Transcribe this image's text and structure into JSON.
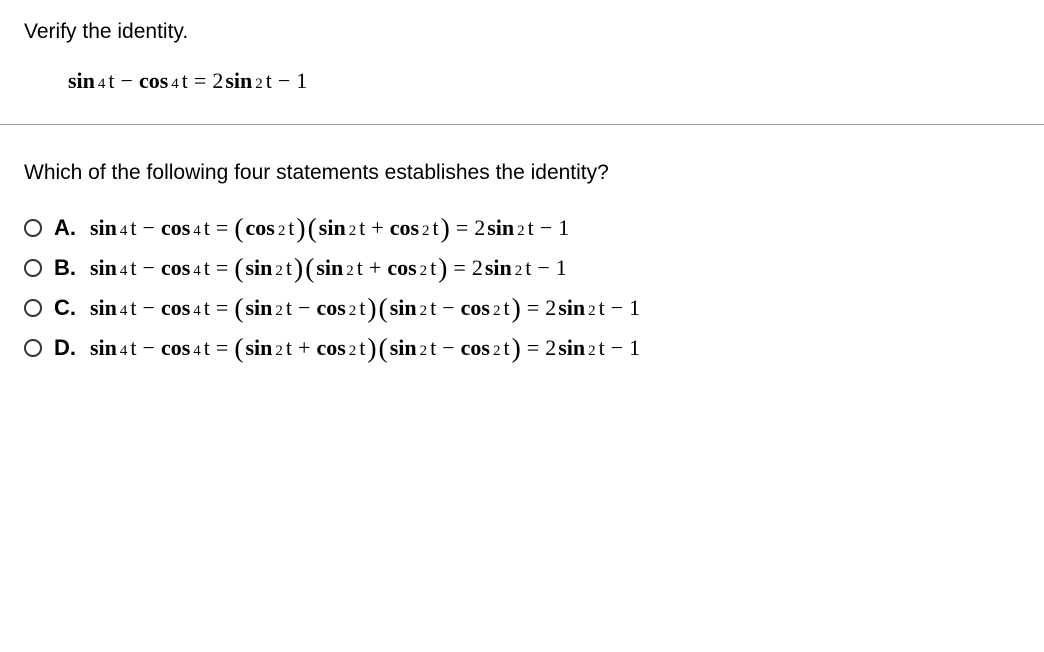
{
  "instruction": "Verify the identity.",
  "main_equation": {
    "lhs_terms": [
      "sin",
      "4",
      "t",
      "−",
      "cos",
      "4",
      "t"
    ],
    "rhs_terms": [
      "2 sin",
      "2",
      "t",
      "−",
      "1"
    ]
  },
  "question": "Which of the following four statements establishes the identity?",
  "choices": [
    {
      "label": "A.",
      "text": "sin⁴ t − cos⁴ t = (cos² t)(sin² t + cos² t) = 2 sin² t − 1"
    },
    {
      "label": "B.",
      "text": "sin⁴ t − cos⁴ t = (sin² t)(sin² t + cos² t) = 2 sin² t − 1"
    },
    {
      "label": "C.",
      "text": "sin⁴ t − cos⁴ t = (sin² t − cos² t)(sin² t − cos² t) = 2 sin² t − 1"
    },
    {
      "label": "D.",
      "text": "sin⁴ t − cos⁴ t = (sin² t + cos² t)(sin² t − cos² t) = 2 sin² t − 1"
    }
  ],
  "labels": {
    "A": "A.",
    "B": "B.",
    "C": "C.",
    "D": "D."
  }
}
